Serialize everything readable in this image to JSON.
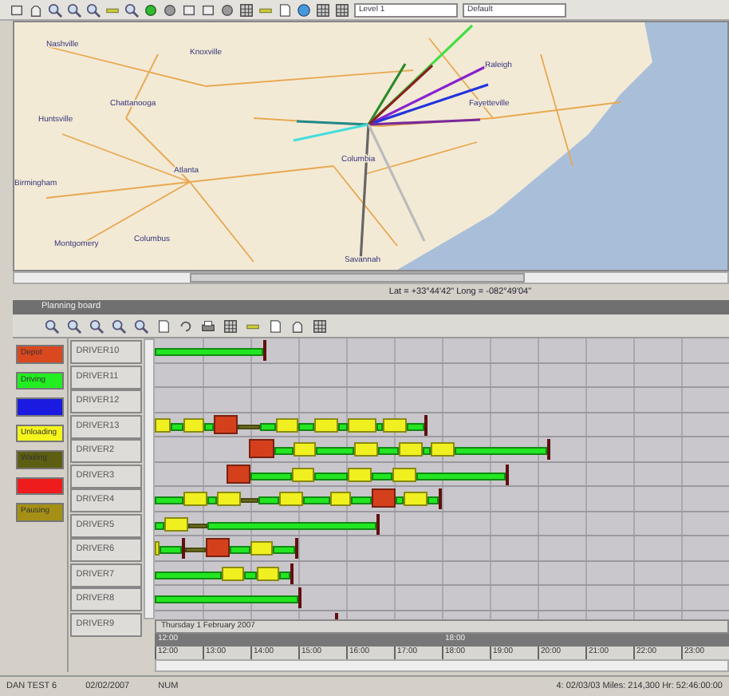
{
  "toolbar": {
    "level_select": "Level 1",
    "style_select": "Default"
  },
  "map": {
    "cities": [
      "Nashville",
      "Knoxville",
      "Chattanooga",
      "Huntsville",
      "Atlanta",
      "Birmingham",
      "Montgomery",
      "Columbus",
      "Columbia",
      "Savannah",
      "Raleigh",
      "Fayetteville"
    ]
  },
  "map_status": "Lat = +33°44'42\" Long = -082°49'04\"",
  "board": {
    "title": "Planning board",
    "legend": [
      {
        "label": "Depot",
        "color": "#d9481e"
      },
      {
        "label": "Driving",
        "color": "#22ee22"
      },
      {
        "color": "#1a1ae0"
      },
      {
        "label": "Unloading",
        "color": "#f5f51e"
      },
      {
        "label": "Waiting",
        "color": "#5e5e12"
      },
      {
        "color": "#ee1c1c"
      },
      {
        "label": "Pausing",
        "color": "#a59015"
      }
    ],
    "drivers": [
      {
        "name": "DRIVER10",
        "segments": [
          {
            "kind": "driving"
          },
          {
            "kind": "end"
          }
        ]
      },
      {
        "name": "DRIVER11"
      },
      {
        "name": "DRIVER12"
      },
      {
        "name": "DRIVER13",
        "segments": [
          {
            "kind": "unloading"
          },
          {
            "kind": "driving"
          },
          {
            "kind": "unloading"
          },
          {
            "kind": "driving"
          },
          {
            "kind": "depot"
          },
          {
            "kind": "waiting"
          },
          {
            "kind": "driving"
          },
          {
            "kind": "unloading"
          },
          {
            "kind": "driving"
          },
          {
            "kind": "unloading"
          },
          {
            "kind": "driving"
          },
          {
            "kind": "unloading"
          },
          {
            "kind": "driving"
          },
          {
            "kind": "unloading"
          },
          {
            "kind": "driving"
          },
          {
            "kind": "end"
          }
        ]
      },
      {
        "name": "DRIVER2",
        "segments": [
          {
            "kind": "depot"
          },
          {
            "kind": "driving"
          },
          {
            "kind": "unloading"
          },
          {
            "kind": "driving"
          },
          {
            "kind": "unloading"
          },
          {
            "kind": "driving"
          },
          {
            "kind": "unloading"
          },
          {
            "kind": "driving"
          },
          {
            "kind": "unloading"
          },
          {
            "kind": "driving"
          },
          {
            "kind": "end"
          }
        ]
      },
      {
        "name": "DRIVER3",
        "segments": [
          {
            "kind": "depot"
          },
          {
            "kind": "driving"
          },
          {
            "kind": "unloading"
          },
          {
            "kind": "driving"
          },
          {
            "kind": "unloading"
          },
          {
            "kind": "driving"
          },
          {
            "kind": "unloading"
          },
          {
            "kind": "driving"
          },
          {
            "kind": "end"
          }
        ]
      },
      {
        "name": "DRIVER4",
        "segments": [
          {
            "kind": "driving"
          },
          {
            "kind": "unloading"
          },
          {
            "kind": "driving"
          },
          {
            "kind": "unloading"
          },
          {
            "kind": "waiting"
          },
          {
            "kind": "driving"
          },
          {
            "kind": "unloading"
          },
          {
            "kind": "driving"
          },
          {
            "kind": "unloading"
          },
          {
            "kind": "driving"
          },
          {
            "kind": "depot"
          },
          {
            "kind": "driving"
          },
          {
            "kind": "unloading"
          },
          {
            "kind": "driving"
          },
          {
            "kind": "end"
          }
        ]
      },
      {
        "name": "DRIVER5",
        "segments": [
          {
            "kind": "driving"
          },
          {
            "kind": "unloading"
          },
          {
            "kind": "waiting"
          },
          {
            "kind": "driving"
          },
          {
            "kind": "end"
          }
        ]
      },
      {
        "name": "DRIVER6",
        "segments": [
          {
            "kind": "unloading"
          },
          {
            "kind": "driving"
          },
          {
            "kind": "end"
          },
          {
            "kind": "waiting"
          },
          {
            "kind": "depot"
          },
          {
            "kind": "driving"
          },
          {
            "kind": "unloading"
          },
          {
            "kind": "driving"
          },
          {
            "kind": "end"
          }
        ]
      },
      {
        "name": "DRIVER7",
        "segments": [
          {
            "kind": "driving"
          },
          {
            "kind": "unloading"
          },
          {
            "kind": "driving"
          },
          {
            "kind": "unloading"
          },
          {
            "kind": "driving"
          },
          {
            "kind": "end"
          }
        ]
      },
      {
        "name": "DRIVER8",
        "segments": [
          {
            "kind": "driving"
          },
          {
            "kind": "end"
          }
        ]
      },
      {
        "name": "DRIVER9",
        "segments": [
          {
            "kind": "end"
          }
        ]
      }
    ],
    "date": "Thursday 1 February 2007",
    "day_marks": [
      "12:00",
      "18:00"
    ],
    "hours": [
      "12:00",
      "13:00",
      "14:00",
      "15:00",
      "16:00",
      "17:00",
      "18:00",
      "19:00",
      "20:00",
      "21:00",
      "22:00",
      "23:00"
    ]
  },
  "status_bar": [
    "DAN TEST 6",
    "02/02/2007",
    "NUM",
    "4: 02/03/03 Miles: 214,300 Hr: 52:46:00:00"
  ]
}
